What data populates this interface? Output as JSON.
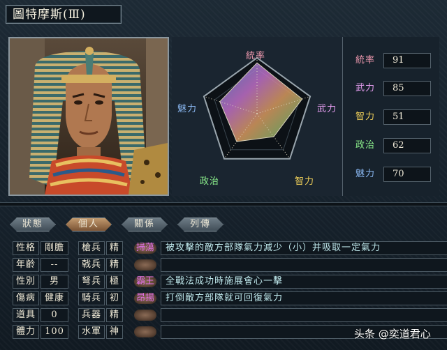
{
  "title": "圖特摩斯(Ⅲ)",
  "radar": {
    "labels": {
      "top": "統率",
      "right": "武力",
      "bottom_right": "智力",
      "bottom_left": "政治",
      "left": "魅力"
    },
    "colors": {
      "top": "#f09ab0",
      "right": "#e59df0",
      "bottom_right": "#f2d25a",
      "bottom_left": "#8cf08c",
      "left": "#8ab8f2"
    }
  },
  "stats": [
    {
      "label": "統率",
      "value": "91",
      "color": "#f09ab0"
    },
    {
      "label": "武力",
      "value": "85",
      "color": "#e59df0"
    },
    {
      "label": "智力",
      "value": "51",
      "color": "#f2d25a"
    },
    {
      "label": "政治",
      "value": "62",
      "color": "#8cf08c"
    },
    {
      "label": "魅力",
      "value": "70",
      "color": "#8ab8f2"
    }
  ],
  "tabs": [
    "狀態",
    "個人",
    "關係",
    "列傳"
  ],
  "active_tab": "個人",
  "personal": [
    {
      "label": "性格",
      "value": "剛膽"
    },
    {
      "label": "年齡",
      "value": "--"
    },
    {
      "label": "性別",
      "value": "男"
    },
    {
      "label": "傷病",
      "value": "健康"
    },
    {
      "label": "道具",
      "value": "0"
    },
    {
      "label": "體力",
      "value": "100"
    }
  ],
  "troops": [
    {
      "label": "槍兵",
      "value": "精"
    },
    {
      "label": "戟兵",
      "value": "精"
    },
    {
      "label": "弩兵",
      "value": "極"
    },
    {
      "label": "騎兵",
      "value": "初"
    },
    {
      "label": "兵器",
      "value": "精"
    },
    {
      "label": "水軍",
      "value": "神"
    }
  ],
  "skills": [
    {
      "name": "掃蕩",
      "name_color": "#e070e8",
      "desc": "被攻擊的敵方部隊氣力減少（小）并吸取一定氣力"
    },
    {
      "name": "",
      "name_color": "#e070e8",
      "desc": ""
    },
    {
      "name": "霸王",
      "name_color": "#e070e8",
      "desc": "全戰法成功時施展會心一擊"
    },
    {
      "name": "昂揚",
      "name_color": "#e070e8",
      "desc": "打倒敵方部隊就可回復氣力"
    },
    {
      "name": "",
      "name_color": "#e070e8",
      "desc": ""
    },
    {
      "name": "",
      "name_color": "#e070e8",
      "desc": ""
    }
  ],
  "watermark": "头条 @奕道君心"
}
